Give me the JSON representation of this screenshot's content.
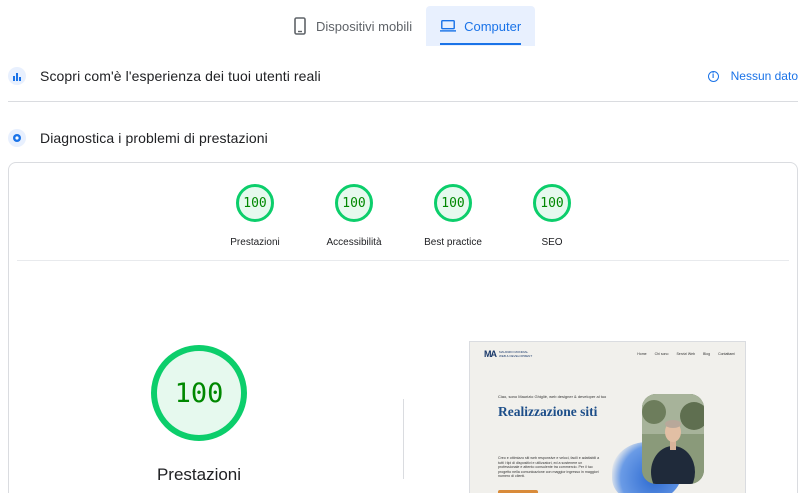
{
  "tabs": [
    {
      "label": "Dispositivi mobili",
      "icon": "mobile-icon",
      "active": false
    },
    {
      "label": "Computer",
      "icon": "desktop-icon",
      "active": true
    }
  ],
  "field_data": {
    "title": "Scopri com'è l'esperienza dei tuoi utenti reali",
    "status": "Nessun dato",
    "status_icon": "info-icon"
  },
  "diagnostics": {
    "title": "Diagnostica i problemi di prestazioni"
  },
  "scores": [
    {
      "label": "Prestazioni",
      "value": "100"
    },
    {
      "label": "Accessibilità",
      "value": "100"
    },
    {
      "label": "Best practice",
      "value": "100"
    },
    {
      "label": "SEO",
      "value": "100"
    }
  ],
  "main_score": {
    "value": "100",
    "label": "Prestazioni"
  },
  "preview": {
    "logo_text": "MAURIZIO MONRIAL WEB & DEVELOPMENT",
    "menu": [
      "Home",
      "Chi sono",
      "Servizi Web",
      "Blog",
      "Contattami"
    ],
    "intro": "Ciao, sono Maurizio Ghigliè, web designer & developer al tuo",
    "headline": "Realizzazione siti",
    "paragraph": "Creo e ottimizzo siti web responsive e veloci, facili e adattabili a tutti i tipi di dispositivi e utilizzatori, ed a sostenere un professionale e attento consulente tra commercio. Per il tuo progetto nella comunicazione con maggior ingresso in maggiori numero di clienti."
  },
  "colors": {
    "accent": "#1a73e8",
    "pass_green": "#0cce6b",
    "pass_fill": "#e6f9ee",
    "pass_text": "#008800"
  }
}
